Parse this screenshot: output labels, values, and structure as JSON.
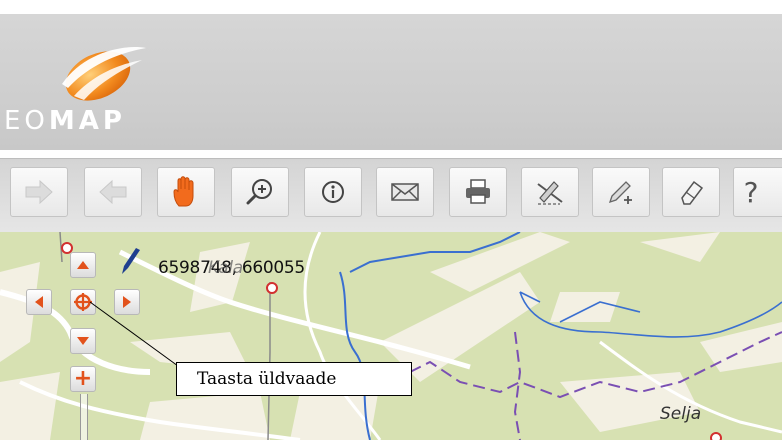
{
  "logo": {
    "text_light": "EO",
    "text_bold": "MAP",
    "brand_color": "#f28a1e"
  },
  "toolbar": {
    "items": [
      {
        "name": "forward-button",
        "icon": "arrow-right-icon",
        "label": ""
      },
      {
        "name": "back-button",
        "icon": "arrow-left-icon",
        "label": ""
      },
      {
        "name": "pan-button",
        "icon": "hand-icon",
        "label": ""
      },
      {
        "name": "zoom-in-tool-button",
        "icon": "magnifier-plus-icon",
        "label": ""
      },
      {
        "name": "info-button",
        "icon": "info-icon",
        "label": ""
      },
      {
        "name": "email-button",
        "icon": "envelope-icon",
        "label": ""
      },
      {
        "name": "print-button",
        "icon": "printer-icon",
        "label": ""
      },
      {
        "name": "measure-button",
        "icon": "measure-icon",
        "label": ""
      },
      {
        "name": "draw-button",
        "icon": "pencil-plus-icon",
        "label": ""
      },
      {
        "name": "erase-button",
        "icon": "eraser-icon",
        "label": ""
      },
      {
        "name": "help-button",
        "icon": "question-icon",
        "label": "?"
      }
    ]
  },
  "map": {
    "coordinates": "6598748, 660055",
    "place_label_partial": "Selja",
    "ghost_label": "Kala",
    "tooltip": "Taasta üldvaade",
    "zoom_in_label": "+"
  }
}
